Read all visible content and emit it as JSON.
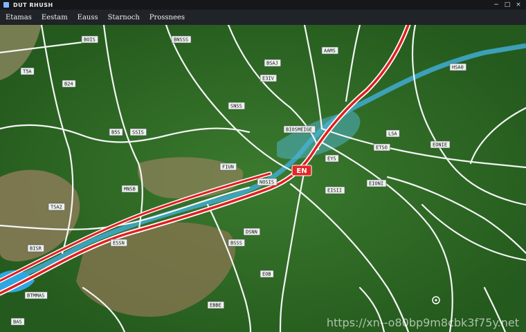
{
  "window": {
    "title": "DUT RHUSH",
    "controls": [
      "−",
      "□",
      "×"
    ]
  },
  "menu": [
    {
      "label": "Etamas"
    },
    {
      "label": "Eestam"
    },
    {
      "label": "Eauss"
    },
    {
      "label": "Starnoch"
    },
    {
      "label": "Prossnees"
    }
  ],
  "map": {
    "highlight_label": "EN",
    "labels": [
      {
        "text": "T5A"
      },
      {
        "text": "B24"
      },
      {
        "text": "BOIS"
      },
      {
        "text": "BNSSS"
      },
      {
        "text": "BSAJ"
      },
      {
        "text": "E3IV"
      },
      {
        "text": "HSA0"
      },
      {
        "text": "AAMS"
      },
      {
        "text": "BIOSMEIGE"
      },
      {
        "text": "SNSS"
      },
      {
        "text": "SSIS"
      },
      {
        "text": "B5S"
      },
      {
        "text": "FIUN"
      },
      {
        "text": "NOSIS"
      },
      {
        "text": "MNSB"
      },
      {
        "text": "EISII"
      },
      {
        "text": "EIONI"
      },
      {
        "text": "ETSO"
      },
      {
        "text": "LSA"
      },
      {
        "text": "EONIE"
      },
      {
        "text": "TSA2"
      },
      {
        "text": "ESSN"
      },
      {
        "text": "BSSS"
      },
      {
        "text": "DSNN"
      },
      {
        "text": "BISR"
      },
      {
        "text": "BTMMAS"
      },
      {
        "text": "BAS"
      },
      {
        "text": "EBBE"
      },
      {
        "text": "EOB"
      },
      {
        "text": "EYS"
      }
    ]
  },
  "watermark": "https://xn--o80bp9m8cbk3f75y.net",
  "colors": {
    "forest": "#2f6a26",
    "forest_dark": "#234f1c",
    "terrain": "#8a7a55",
    "river": "#3fa7c9",
    "highway": "#e01f1f",
    "road": "#f4f6f5"
  }
}
